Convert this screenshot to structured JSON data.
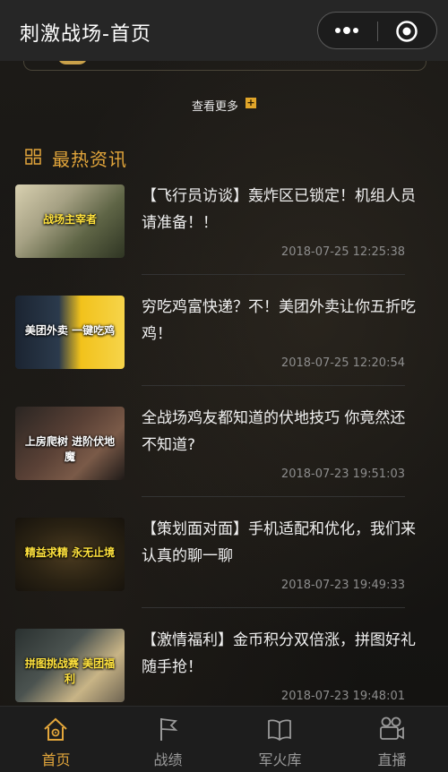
{
  "header": {
    "title": "刺激战场-首页"
  },
  "colors": {
    "accent": "#e3a63b",
    "tab_inactive": "#9a9a9a",
    "background": "#171717"
  },
  "more": {
    "label": "查看更多",
    "icon": "plus-icon"
  },
  "section": {
    "title": "最热资讯",
    "icon": "grid-icon"
  },
  "news": [
    {
      "title": "【飞行员访谈】轰炸区已锁定！机组人员请准备！！",
      "time": "2018-07-25 12:25:38",
      "thumb_text": "战场主宰者"
    },
    {
      "title": "穷吃鸡富快递？不！美团外卖让你五折吃鸡！",
      "time": "2018-07-25 12:20:54",
      "thumb_text": "美团外卖 一键吃鸡"
    },
    {
      "title": "全战场鸡友都知道的伏地技巧 你竟然还不知道?",
      "time": "2018-07-23 19:51:03",
      "thumb_text": "上房爬树 进阶伏地魔"
    },
    {
      "title": "【策划面对面】手机适配和优化，我们来认真的聊一聊",
      "time": "2018-07-23 19:49:33",
      "thumb_text": "精益求精 永无止境"
    },
    {
      "title": "【激情福利】金币积分双倍涨，拼图好礼随手抢！",
      "time": "2018-07-23 19:48:01",
      "thumb_text": "拼图挑战赛 美团福利"
    }
  ],
  "tabs": [
    {
      "label": "首页",
      "icon": "home-icon",
      "active": true
    },
    {
      "label": "战绩",
      "icon": "flag-icon",
      "active": false
    },
    {
      "label": "军火库",
      "icon": "book-icon",
      "active": false
    },
    {
      "label": "直播",
      "icon": "camera-icon",
      "active": false
    }
  ]
}
